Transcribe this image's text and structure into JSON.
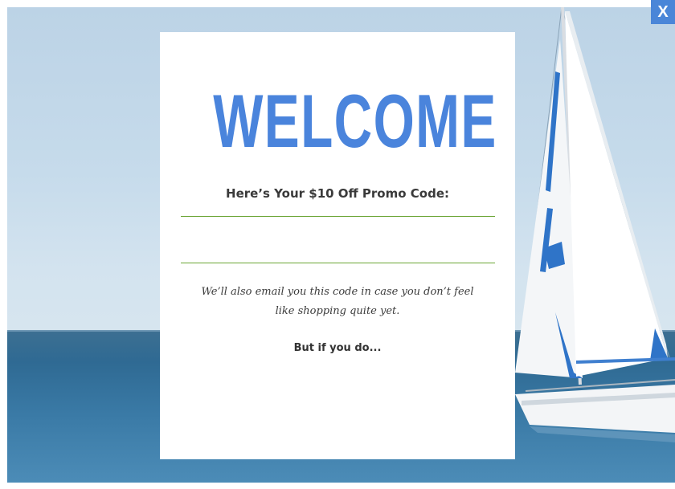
{
  "popup": {
    "close_label": "X",
    "welcome_title": "WELCOME",
    "promo_heading": "Here’s Your $10 Off Promo Code:",
    "promo_code_value": "",
    "note_line_1": "We’ll also email you this code in case you don’t feel",
    "note_line_2": "like shopping quite yet.",
    "but_if_text": "But if you do..."
  },
  "colors": {
    "accent_blue": "#4a84dc",
    "close_button_bg": "#4a86d8",
    "field_border_green": "#6aa534",
    "card_background": "#ffffff"
  },
  "icons": {
    "close": "close-icon"
  },
  "background": {
    "scene": "sailboat-on-sea-photo"
  }
}
